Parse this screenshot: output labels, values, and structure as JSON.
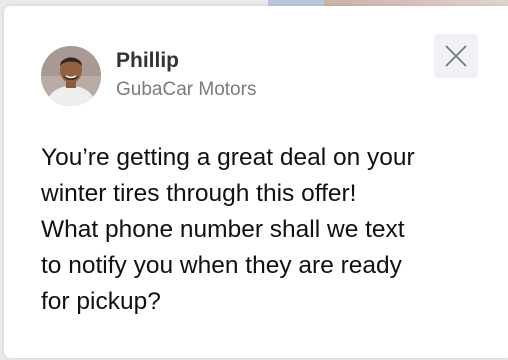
{
  "sender": {
    "name": "Phillip",
    "company": "GubaCar Motors"
  },
  "message": {
    "lines": [
      "You’re getting a great deal on your",
      "winter tires through this offer!",
      "What phone number shall we text",
      "to notify you when they are ready",
      "for pickup?"
    ]
  },
  "icons": {
    "close": "close-icon",
    "avatar": "avatar-photo"
  },
  "colors": {
    "card_background": "#ffffff",
    "close_button_background": "#f0f1f4",
    "name_text": "#333333",
    "company_text": "#7b7b7b"
  }
}
